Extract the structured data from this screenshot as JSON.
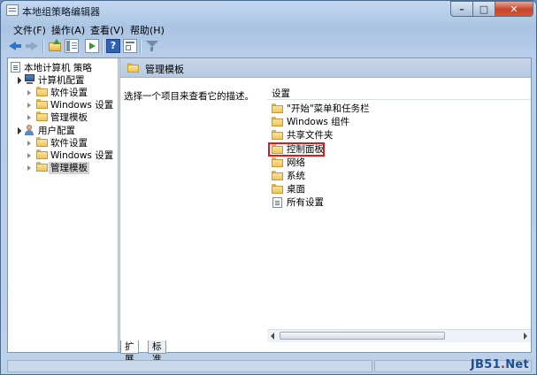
{
  "window": {
    "title": "本地组策略编辑器",
    "controls": {
      "minimize": "–",
      "maximize": "□",
      "close": "✕"
    }
  },
  "menu": [
    "文件(F)",
    "操作(A)",
    "查看(V)",
    "帮助(H)"
  ],
  "toolbar": {
    "help": "?"
  },
  "tree": [
    {
      "label": "本地计算机 策略",
      "icon": "policy-doc-icon",
      "expanded": true
    },
    {
      "label": "计算机配置",
      "icon": "computer-icon",
      "expanded": true
    },
    {
      "label": "软件设置",
      "icon": "folder-icon",
      "expanded": false
    },
    {
      "label": "Windows 设置",
      "icon": "folder-icon",
      "expanded": false
    },
    {
      "label": "管理模板",
      "icon": "folder-icon",
      "expanded": false
    },
    {
      "label": "用户配置",
      "icon": "user-icon",
      "expanded": true
    },
    {
      "label": "软件设置",
      "icon": "folder-icon",
      "expanded": false
    },
    {
      "label": "Windows 设置",
      "icon": "folder-icon",
      "expanded": false
    },
    {
      "label": "管理模板",
      "icon": "folder-icon",
      "expanded": false,
      "selected": true
    }
  ],
  "details": {
    "header": "管理模板",
    "description": "选择一个项目来查看它的描述。",
    "column_header": "设置",
    "items": [
      {
        "label": "\"开始\"菜单和任务栏",
        "icon": "folder-icon"
      },
      {
        "label": "Windows 组件",
        "icon": "folder-icon"
      },
      {
        "label": "共享文件夹",
        "icon": "folder-icon"
      },
      {
        "label": "控制面板",
        "icon": "folder-icon",
        "highlighted": true
      },
      {
        "label": "网络",
        "icon": "folder-icon"
      },
      {
        "label": "系统",
        "icon": "folder-icon"
      },
      {
        "label": "桌面",
        "icon": "folder-icon"
      },
      {
        "label": "所有设置",
        "icon": "settings-doc-icon"
      }
    ]
  },
  "tabs": [
    "扩展",
    "标准"
  ],
  "active_tab": "扩展",
  "watermark": {
    "text": "JB51",
    "accent": ".",
    "suffix": "Net"
  },
  "colors": {
    "highlight": "#e0161b",
    "accent": "#2f75c6"
  }
}
